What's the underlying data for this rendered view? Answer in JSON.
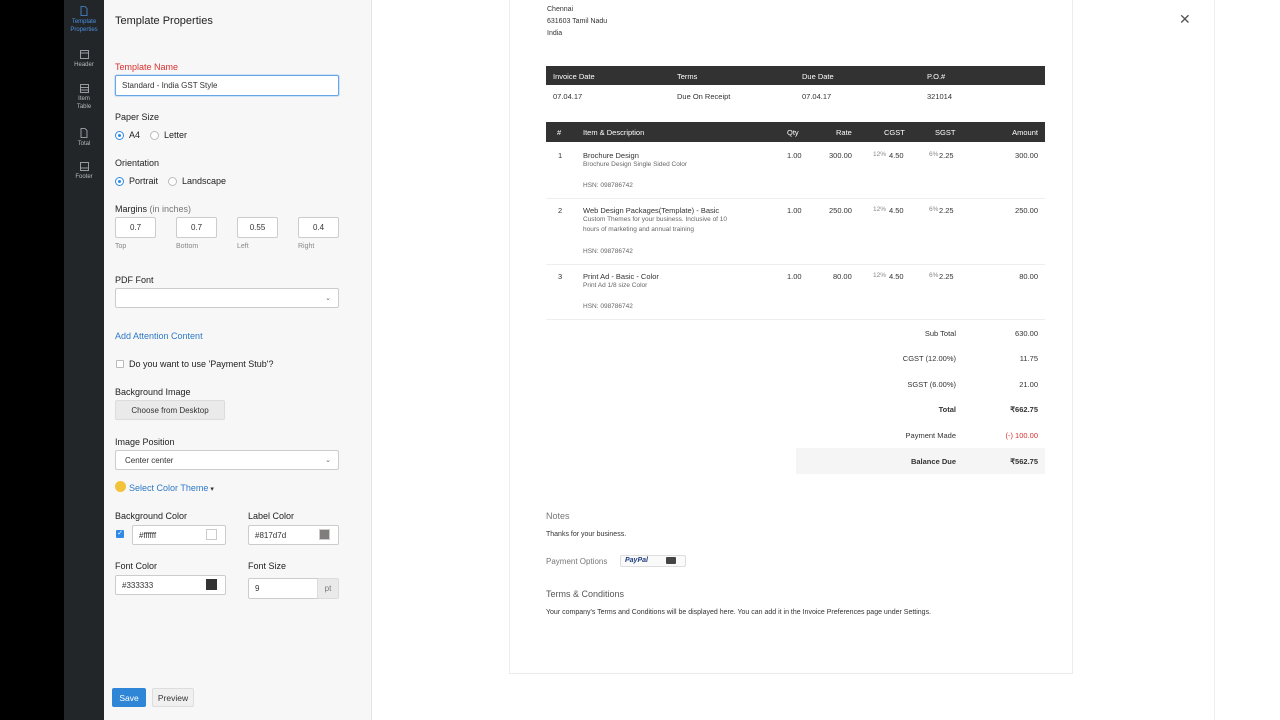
{
  "rail": {
    "items": [
      {
        "label": "Template Properties",
        "icon": "document-icon"
      },
      {
        "label": "Header",
        "icon": "header-icon"
      },
      {
        "label": "Item Table",
        "icon": "table-icon"
      },
      {
        "label": "Total",
        "icon": "total-icon"
      },
      {
        "label": "Footer",
        "icon": "footer-icon"
      }
    ]
  },
  "panel": {
    "title": "Template Properties",
    "template_name_label": "Template Name",
    "template_name_value": "Standard - India GST Style",
    "paper_size_label": "Paper Size",
    "paper_a4": "A4",
    "paper_letter": "Letter",
    "orientation_label": "Orientation",
    "portrait": "Portrait",
    "landscape": "Landscape",
    "margins_label": "Margins",
    "margins_unit": "(in inches)",
    "margins": [
      {
        "value": "0.7",
        "label": "Top"
      },
      {
        "value": "0.7",
        "label": "Bottom"
      },
      {
        "value": "0.55",
        "label": "Left"
      },
      {
        "value": "0.4",
        "label": "Right"
      }
    ],
    "pdf_font_label": "PDF Font",
    "pdf_font_value": "",
    "attention_link": "Add Attention Content",
    "payment_stub_label": "Do you want to use 'Payment Stub'?",
    "bg_image_label": "Background Image",
    "choose_button": "Choose from Desktop",
    "image_position_label": "Image Position",
    "image_position_value": "Center center",
    "color_theme_link": "Select Color Theme",
    "bg_color_label": "Background Color",
    "bg_color_value": "#ffffff",
    "label_color_label": "Label Color",
    "label_color_value": "#817d7d",
    "font_color_label": "Font Color",
    "font_color_value": "#333333",
    "font_size_label": "Font Size",
    "font_size_value": "9",
    "font_size_unit": "pt",
    "save": "Save",
    "preview": "Preview"
  },
  "colors": {
    "accent": "#2f86d6",
    "bar": "#323232",
    "balance_bg": "#f5f5f5",
    "payment_made": "#d6312d"
  },
  "invoice": {
    "address": [
      "Chennai",
      "631603 Tamil Nadu",
      "India"
    ],
    "meta_headers": [
      "Invoice Date",
      "Terms",
      "Due Date",
      "P.O.#"
    ],
    "meta_values": [
      "07.04.17",
      "Due On Receipt",
      "07.04.17",
      "321014"
    ],
    "item_headers": [
      "#",
      "Item & Description",
      "Qty",
      "Rate",
      "CGST",
      "SGST",
      "Amount"
    ],
    "items": [
      {
        "num": "1",
        "name": "Brochure Design",
        "desc": "Brochure Design Single Sided Color",
        "desc2": "",
        "hsn": "HSN: 098786742",
        "qty": "1.00",
        "rate": "300.00",
        "cgst_pct": "12%",
        "cgst": "4.50",
        "sgst_pct": "6%",
        "sgst": "2.25",
        "amount": "300.00"
      },
      {
        "num": "2",
        "name": "Web Design Packages(Template) - Basic",
        "desc": "Custom Themes for your business. Inclusive of 10",
        "desc2": "hours of marketing and annual training",
        "hsn": "HSN: 098786742",
        "qty": "1.00",
        "rate": "250.00",
        "cgst_pct": "12%",
        "cgst": "4.50",
        "sgst_pct": "6%",
        "sgst": "2.25",
        "amount": "250.00"
      },
      {
        "num": "3",
        "name": "Print Ad - Basic - Color",
        "desc": "Print Ad 1/8 size Color",
        "desc2": "",
        "hsn": "HSN: 098786742",
        "qty": "1.00",
        "rate": "80.00",
        "cgst_pct": "12%",
        "cgst": "4.50",
        "sgst_pct": "6%",
        "sgst": "2.25",
        "amount": "80.00"
      }
    ],
    "totals": [
      {
        "label": "Sub Total",
        "value": "630.00"
      },
      {
        "label": "CGST (12.00%)",
        "value": "11.75"
      },
      {
        "label": "SGST (6.00%)",
        "value": "21.00"
      },
      {
        "label": "Total",
        "value": "₹662.75"
      },
      {
        "label": "Payment Made",
        "value": "(-) 100.00"
      },
      {
        "label": "Balance Due",
        "value": "₹562.75"
      }
    ],
    "notes_title": "Notes",
    "notes_text": "Thanks for your business.",
    "payment_options_label": "Payment Options",
    "paypal_label": "PayPal",
    "terms_title": "Terms & Conditions",
    "terms_text": "Your company's Terms and Conditions will be displayed here. You can add it in the Invoice Preferences page under Settings."
  }
}
